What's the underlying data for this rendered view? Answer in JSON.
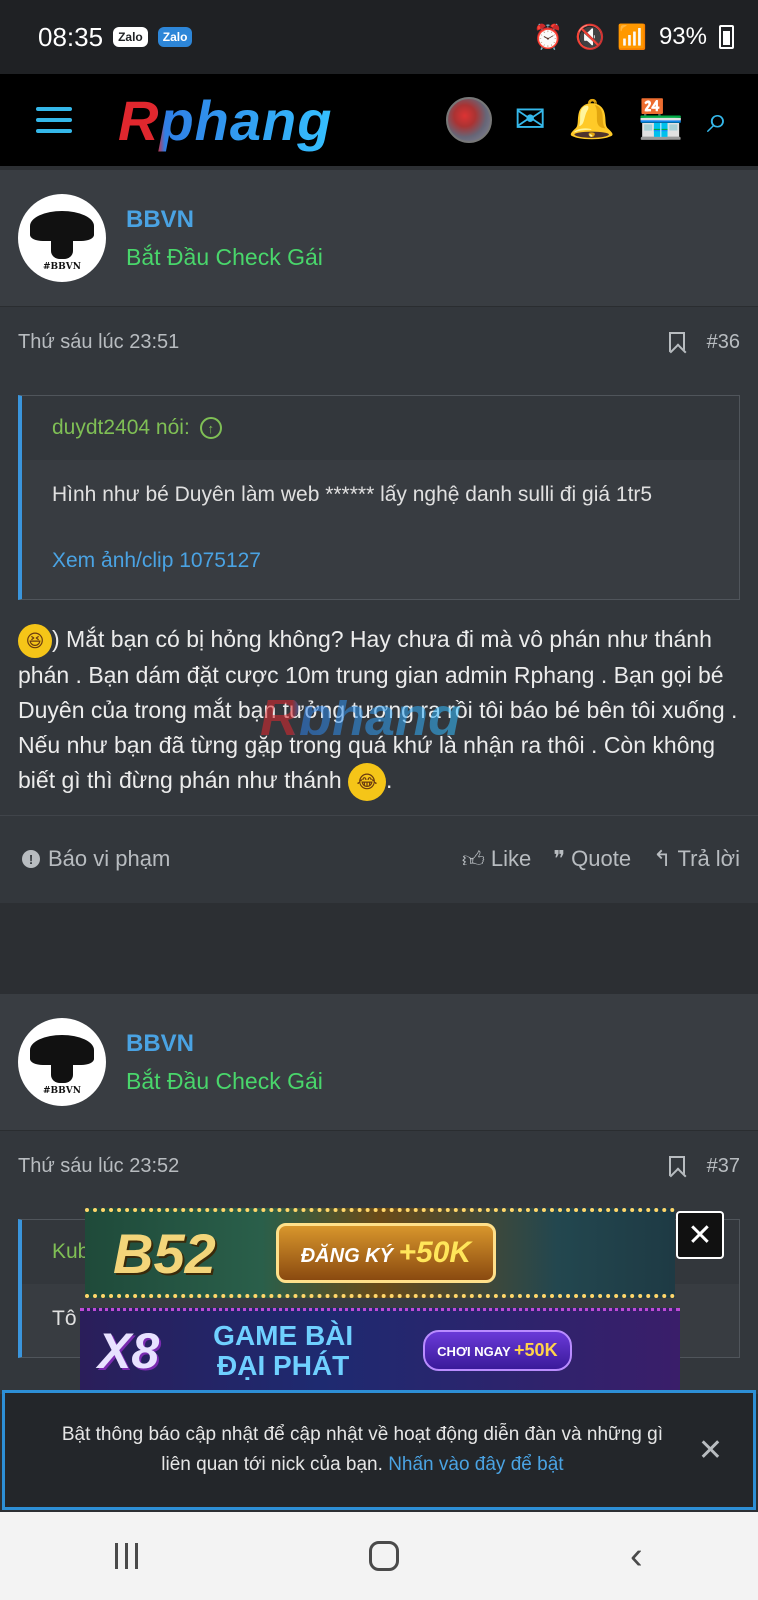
{
  "status_bar": {
    "time": "08:35",
    "app1": "Zalo",
    "app2": "Zalo",
    "battery": "93%",
    "icons": [
      "alarm-icon",
      "mute-icon",
      "wifi-icon",
      "signal-icon"
    ]
  },
  "header": {
    "logo": "Rphang",
    "icons": [
      "menu-icon",
      "avatar",
      "mail-icon",
      "bell-icon",
      "store-icon",
      "search-icon"
    ],
    "accent": "#35b8ea"
  },
  "posts": [
    {
      "username": "BBVN",
      "user_title": "Bắt Đầu Check Gái",
      "avatar_tag": "#BBVN",
      "time": "Thứ sáu lúc 23:51",
      "number": "#36",
      "quote": {
        "author": "duydt2404 nói:",
        "text": "Hình như bé Duyên làm web ****** lấy nghệ danh sulli đi giá 1tr5",
        "link": "Xem ảnh/clip 1075127"
      },
      "body": ") Mắt bạn có bị hỏng không? Hay chưa đi mà vô phán như thánh phán . Bạn dám đặt cược 10m trung gian admin Rphang . Bạn gọi bé Duyên của trong mắt bạn tưởng tượng ra rồi tôi báo bé bên tôi xuống . Nếu như bạn đã từng gặp trong quá khứ là nhận ra thôi . Còn không biết gì thì đừng phán như thánh",
      "body_end": ".",
      "watermark": "Rphang"
    },
    {
      "username": "BBVN",
      "user_title": "Bắt Đầu Check Gái",
      "avatar_tag": "#BBVN",
      "time": "Thứ sáu lúc 23:52",
      "number": "#37",
      "quote": {
        "author": "Kub",
        "text": "Tô"
      }
    }
  ],
  "actions": {
    "report": "Báo vi phạm",
    "like": "Like",
    "quote": "Quote",
    "reply": "Trả lời"
  },
  "ads": {
    "ad1": {
      "logo": "B52",
      "cta": "ĐĂNG KÝ",
      "cta_bonus": "+50K"
    },
    "ad2": {
      "logo": "X8",
      "line1": "GAME BÀI",
      "line2": "ĐẠI PHÁT",
      "cta": "CHƠI NGAY",
      "cta_bonus": "+50K"
    }
  },
  "notice": {
    "text": "Bật thông báo cập nhật để cập nhật về hoạt động diễn đàn và những gì liên quan tới nick của bạn.",
    "link": "Nhấn vào đây để bật"
  },
  "colors": {
    "username": "#4aa3e3",
    "user_title": "#49d66b",
    "quote_author": "#7fbf55",
    "notice_border": "#2d8fd6"
  }
}
